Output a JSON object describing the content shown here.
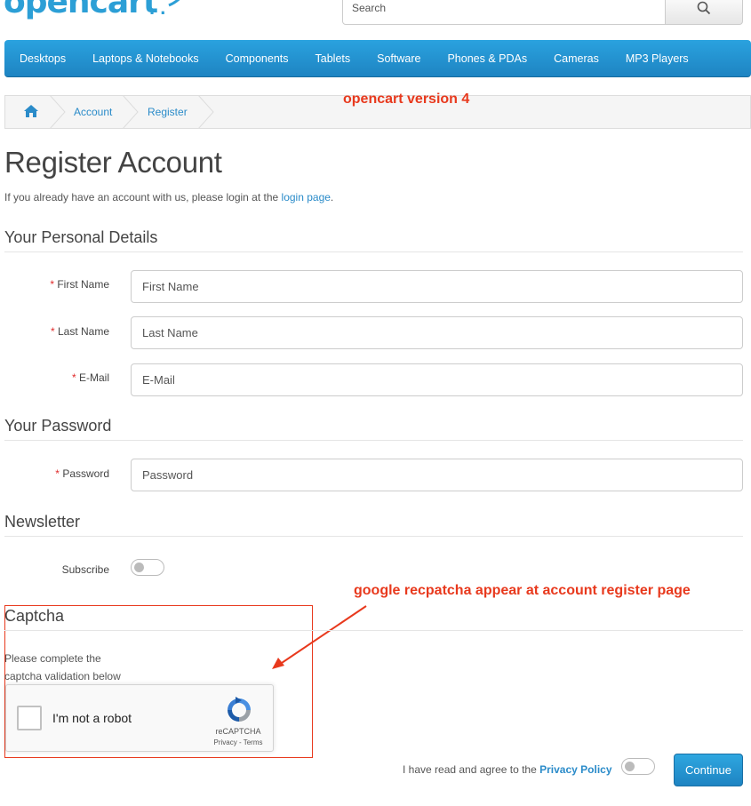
{
  "logo": {
    "text": "opencart",
    "dots": ". ."
  },
  "search": {
    "placeholder": "Search",
    "icon": "search-icon"
  },
  "nav": {
    "items": [
      {
        "label": "Desktops"
      },
      {
        "label": "Laptops & Notebooks"
      },
      {
        "label": "Components"
      },
      {
        "label": "Tablets"
      },
      {
        "label": "Software"
      },
      {
        "label": "Phones & PDAs"
      },
      {
        "label": "Cameras"
      },
      {
        "label": "MP3 Players"
      }
    ]
  },
  "breadcrumb": {
    "home_icon": "home-icon",
    "items": [
      "Account",
      "Register"
    ]
  },
  "annotations": {
    "version_note": "opencart version 4",
    "captcha_note": "google recpatcha appear at account register page"
  },
  "page": {
    "title": "Register Account",
    "intro_prefix": "If you already have an account with us, please login at the ",
    "intro_link": "login page",
    "intro_suffix": "."
  },
  "sections": {
    "personal": "Your Personal Details",
    "password": "Your Password",
    "newsletter": "Newsletter",
    "captcha": "Captcha"
  },
  "fields": {
    "first_name": {
      "label": "First Name",
      "placeholder": "First Name",
      "required": "*"
    },
    "last_name": {
      "label": "Last Name",
      "placeholder": "Last Name",
      "required": "*"
    },
    "email": {
      "label": "E-Mail",
      "placeholder": "E-Mail",
      "required": "*"
    },
    "password": {
      "label": "Password",
      "placeholder": "Password",
      "required": "*"
    }
  },
  "newsletter": {
    "label": "Subscribe",
    "subscribed": false
  },
  "captcha": {
    "instructions": "Please complete the captcha validation below",
    "checkbox_label": "I'm not a robot",
    "brand": "reCAPTCHA",
    "privacy": "Privacy",
    "separator": " - ",
    "terms": "Terms"
  },
  "footer": {
    "agree_prefix": "I have read and agree to the ",
    "agree_link": "Privacy Policy",
    "agreed": false,
    "continue_label": "Continue"
  },
  "colors": {
    "accent": "#2a8bc9",
    "nav_top": "#2aa2df",
    "nav_bottom": "#1e84c2",
    "annotation_red": "#e8391d",
    "required_red": "#e02a2a"
  }
}
